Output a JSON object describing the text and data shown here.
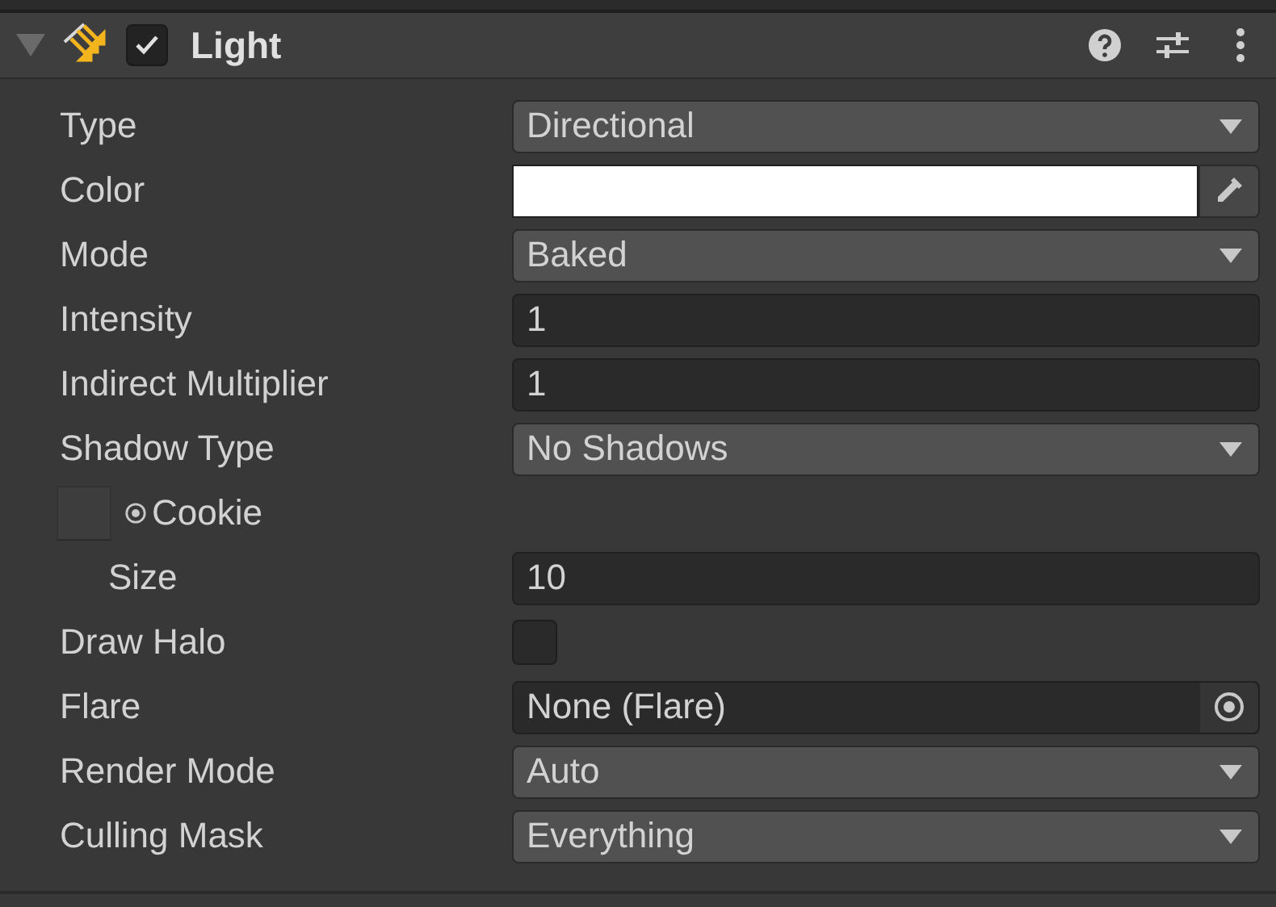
{
  "component": {
    "title": "Light",
    "enabled": true,
    "expanded": true
  },
  "properties": [
    {
      "kind": "dropdown",
      "label": "Type",
      "value": "Directional"
    },
    {
      "kind": "color",
      "label": "Color",
      "color": "#ffffff"
    },
    {
      "kind": "dropdown",
      "label": "Mode",
      "value": "Baked"
    },
    {
      "kind": "number",
      "label": "Intensity",
      "value": "1"
    },
    {
      "kind": "number",
      "label": "Indirect Multiplier",
      "value": "1"
    },
    {
      "kind": "dropdown",
      "label": "Shadow Type",
      "value": "No Shadows"
    },
    {
      "kind": "texture",
      "label": "Cookie",
      "children": [
        {
          "kind": "number",
          "label": "Size",
          "value": "10"
        }
      ]
    },
    {
      "kind": "checkbox",
      "label": "Draw Halo",
      "checked": false
    },
    {
      "kind": "object",
      "label": "Flare",
      "value": "None (Flare)"
    },
    {
      "kind": "dropdown",
      "label": "Render Mode",
      "value": "Auto"
    },
    {
      "kind": "dropdown",
      "label": "Culling Mask",
      "value": "Everything"
    }
  ]
}
